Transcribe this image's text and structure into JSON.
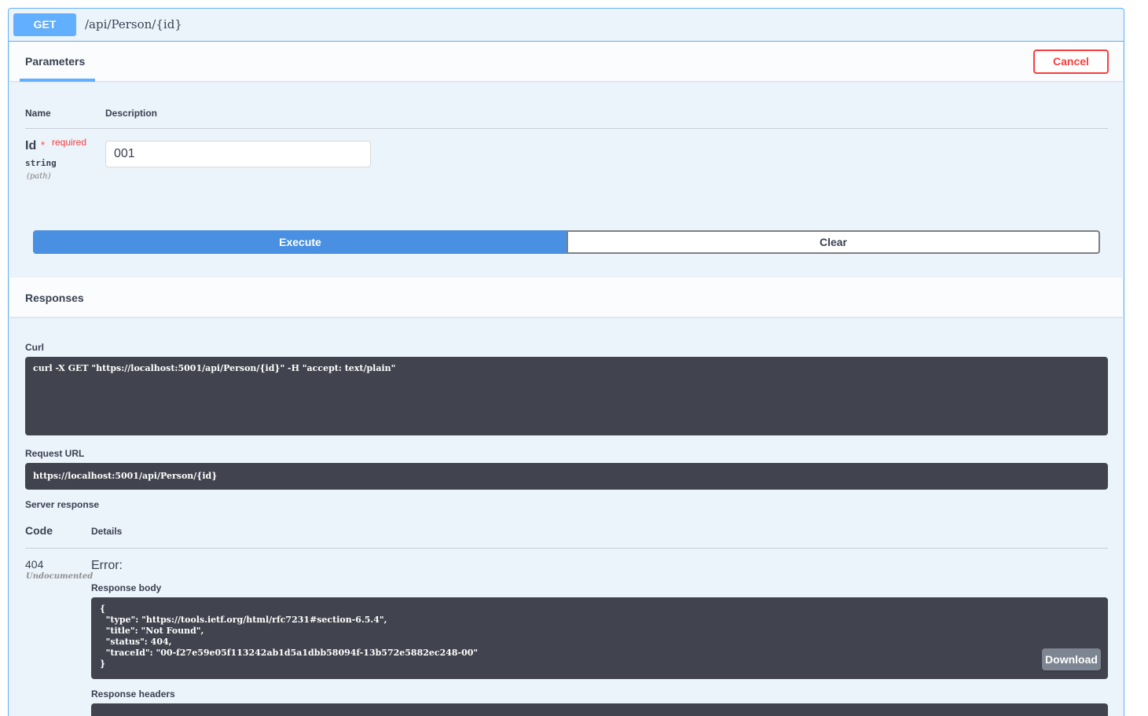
{
  "operation": {
    "method": "GET",
    "path": "/api/Person/{id}"
  },
  "parameters": {
    "tab_label": "Parameters",
    "cancel_label": "Cancel",
    "col_name": "Name",
    "col_description": "Description",
    "items": [
      {
        "name": "Id",
        "star": "*",
        "required_label": "required",
        "type": "string",
        "location": "(path)",
        "value": "001"
      }
    ]
  },
  "actions": {
    "execute_label": "Execute",
    "clear_label": "Clear"
  },
  "responses": {
    "title": "Responses",
    "curl_label": "Curl",
    "curl_command": "curl -X GET \"https://localhost:5001/api/Person/{id}\" -H \"accept: text/plain\"",
    "request_url_label": "Request URL",
    "request_url": "https://localhost:5001/api/Person/{id}",
    "server_response_label": "Server response",
    "code_header": "Code",
    "details_header": "Details",
    "status_code": "404",
    "status_note": "Undocumented",
    "error_label": "Error:",
    "response_body_label": "Response body",
    "response_body": "{\n  \"type\": \"https://tools.ietf.org/html/rfc7231#section-6.5.4\",\n  \"title\": \"Not Found\",\n  \"status\": 404,\n  \"traceId\": \"00-f27e59e05f113242ab1d5a1dbb58094f-13b572e5882ec248-00\"\n}",
    "download_label": "Download",
    "response_headers_label": "Response headers"
  },
  "colors": {
    "get_blue": "#61affe",
    "execute_blue": "#4990e2",
    "cancel_red": "#f93e3e",
    "code_bg": "#41444e"
  }
}
